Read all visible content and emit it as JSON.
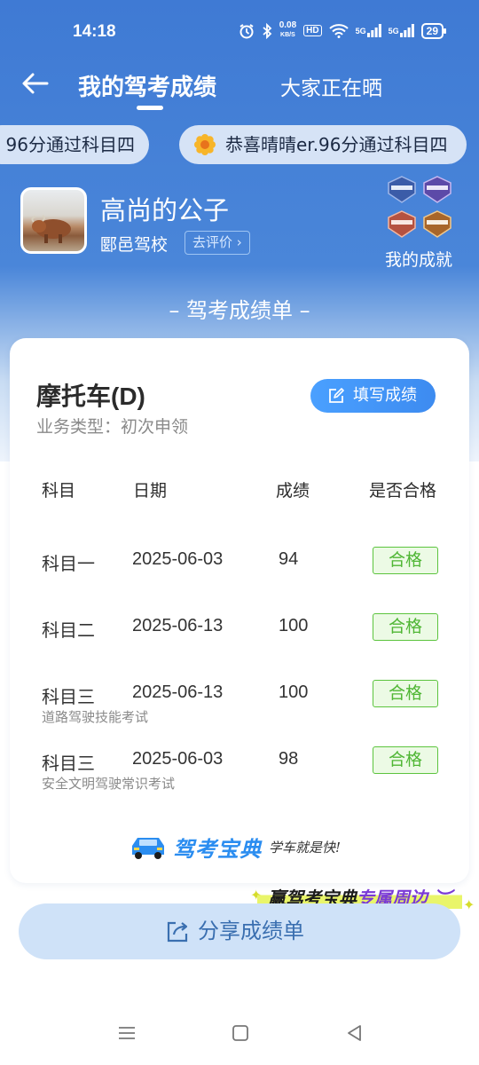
{
  "status": {
    "time": "14:18",
    "net_speed_value": "0.08",
    "net_speed_unit": "KB/S",
    "hd": "HD",
    "sim1": "5G",
    "sim2": "5G",
    "battery": "29"
  },
  "header": {
    "tab_mine": "我的驾考成绩",
    "tab_others": "大家正在晒"
  },
  "ticker": {
    "item1": "96分通过科目四",
    "item2": "恭喜晴晴er.96分通过科目四"
  },
  "profile": {
    "name": "高尚的公子",
    "school": "郾邑驾校",
    "rate_label": "去评价",
    "achievements_label": "我的成就"
  },
  "section_title": "– 驾考成绩单 –",
  "card": {
    "license": "摩托车(D)",
    "business_type": "业务类型：初次申领",
    "fill_button": "填写成绩",
    "columns": [
      "科目",
      "日期",
      "成绩",
      "是否合格"
    ],
    "rows": [
      {
        "subject": "科目一",
        "date": "2025-06-03",
        "score": "94",
        "result": "合格",
        "sub": ""
      },
      {
        "subject": "科目二",
        "date": "2025-06-13",
        "score": "100",
        "result": "合格",
        "sub": ""
      },
      {
        "subject": "科目三",
        "date": "2025-06-13",
        "score": "100",
        "result": "合格",
        "sub": "道路驾驶技能考试"
      },
      {
        "subject": "科目三",
        "date": "2025-06-03",
        "score": "98",
        "result": "合格",
        "sub": "安全文明驾驶常识考试"
      }
    ],
    "brand": "驾考宝典",
    "slogan": "学车就是快!"
  },
  "promo": {
    "prefix": "赢驾考宝典",
    "highlight": "专属周边"
  },
  "share_button": "分享成绩单",
  "colors": {
    "header_blue": "#3f7ad4",
    "accent_blue": "#3d8bf0",
    "pass_green": "#4fb634"
  }
}
